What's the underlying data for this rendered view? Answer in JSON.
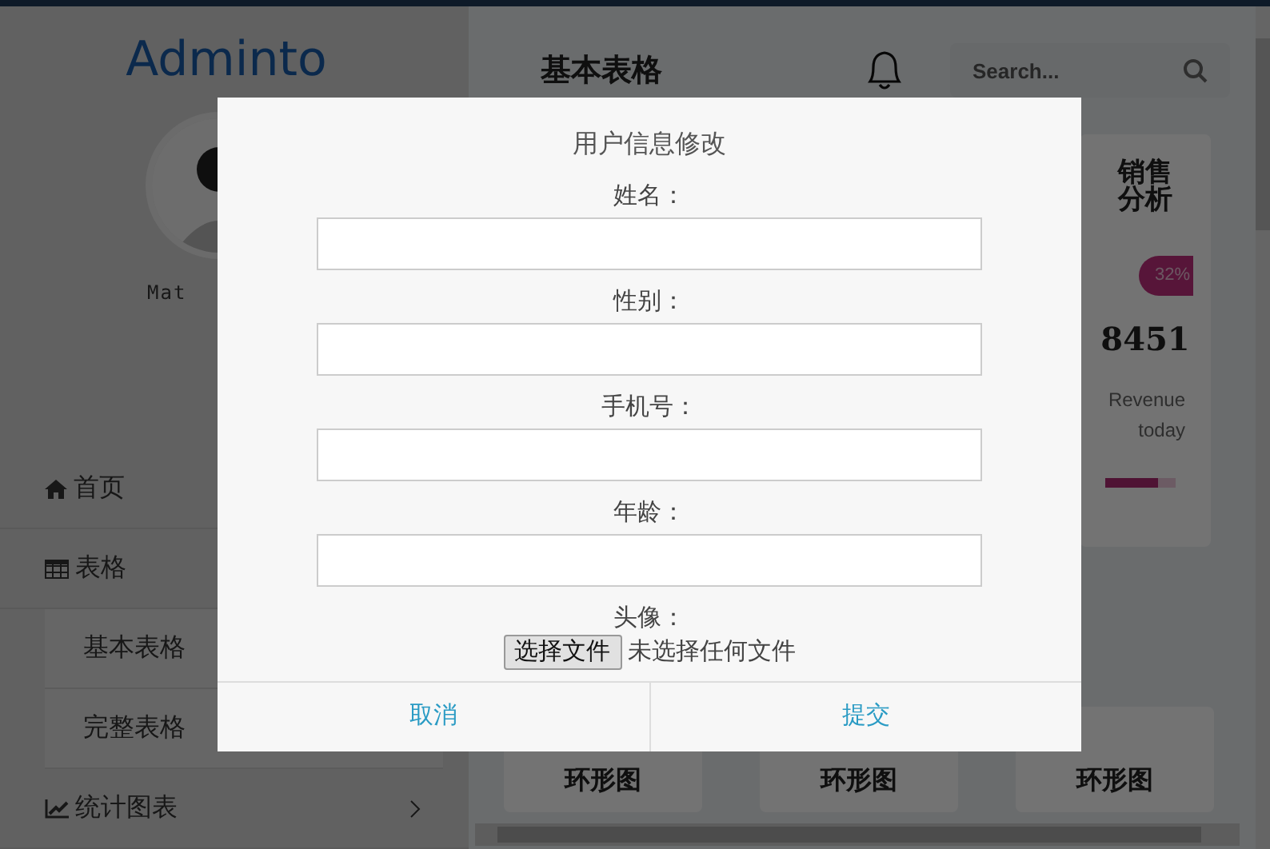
{
  "sidebar": {
    "logo": "Adminto",
    "user_name": "Mat",
    "items": [
      {
        "label": "首页"
      },
      {
        "label": "表格",
        "expanded": true,
        "children": [
          {
            "label": "基本表格"
          },
          {
            "label": "完整表格"
          }
        ]
      },
      {
        "label": "统计图表",
        "expanded": false
      }
    ]
  },
  "header": {
    "title": "基本表格",
    "search": {
      "placeholder": "Search..."
    }
  },
  "stat_card": {
    "title": "销售分析",
    "badge": "32%",
    "value": "8451",
    "caption": "Revenue today",
    "level": 0.75
  },
  "chart_cards": [
    {
      "title": "环形图"
    },
    {
      "title": "环形图"
    },
    {
      "title": "环形图"
    }
  ],
  "dialog": {
    "title": "用户信息修改",
    "fields": [
      {
        "label": "姓名：",
        "kind": "text"
      },
      {
        "label": "性别：",
        "kind": "text"
      },
      {
        "label": "手机号：",
        "kind": "text"
      },
      {
        "label": "年龄：",
        "kind": "text"
      },
      {
        "label": "头像：",
        "kind": "file",
        "button": "选择文件",
        "status": "未选择任何文件"
      }
    ],
    "buttons": [
      "取消",
      "提交"
    ]
  }
}
